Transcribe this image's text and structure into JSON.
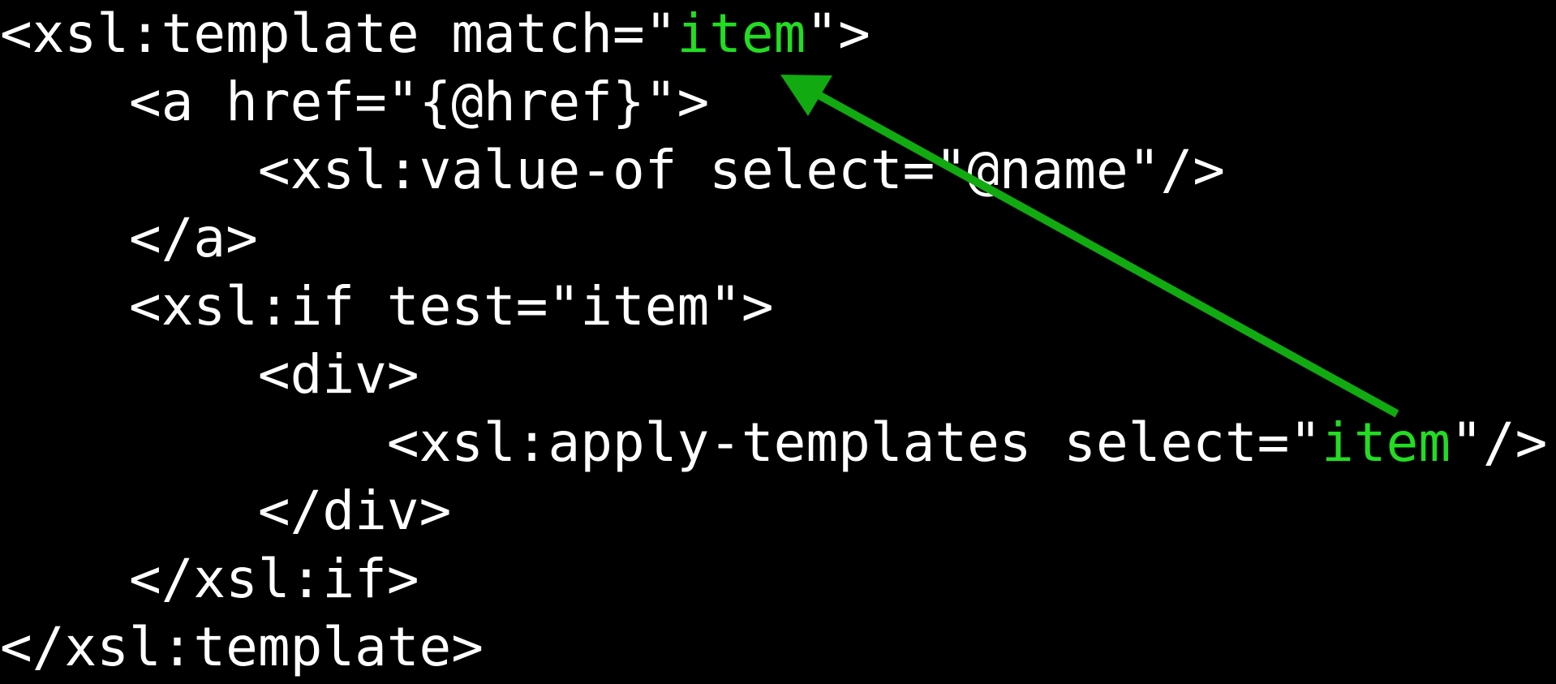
{
  "accent_color": "#22dd22",
  "arrow_color": "#11aa11",
  "code": {
    "lines": [
      {
        "indent": "",
        "parts": [
          {
            "text": "<xsl:template match=\""
          },
          {
            "text": "item",
            "highlight": true
          },
          {
            "text": "\">"
          }
        ]
      },
      {
        "indent": "    ",
        "parts": [
          {
            "text": "<a href=\"{@href}\">"
          }
        ]
      },
      {
        "indent": "        ",
        "parts": [
          {
            "text": "<xsl:value-of select=\"@name\"/>"
          }
        ]
      },
      {
        "indent": "    ",
        "parts": [
          {
            "text": "</a>"
          }
        ]
      },
      {
        "indent": "    ",
        "parts": [
          {
            "text": "<xsl:if test=\"item\">"
          }
        ]
      },
      {
        "indent": "        ",
        "parts": [
          {
            "text": "<div>"
          }
        ]
      },
      {
        "indent": "            ",
        "parts": [
          {
            "text": "<xsl:apply-templates select=\""
          },
          {
            "text": "item",
            "highlight": true
          },
          {
            "text": "\"/>"
          }
        ]
      },
      {
        "indent": "        ",
        "parts": [
          {
            "text": "</div>"
          }
        ]
      },
      {
        "indent": "    ",
        "parts": [
          {
            "text": "</xsl:if>"
          }
        ]
      },
      {
        "indent": "",
        "parts": [
          {
            "text": "</xsl:template>"
          }
        ]
      }
    ]
  },
  "arrow": {
    "from": "apply-templates select item",
    "to": "template match item"
  }
}
